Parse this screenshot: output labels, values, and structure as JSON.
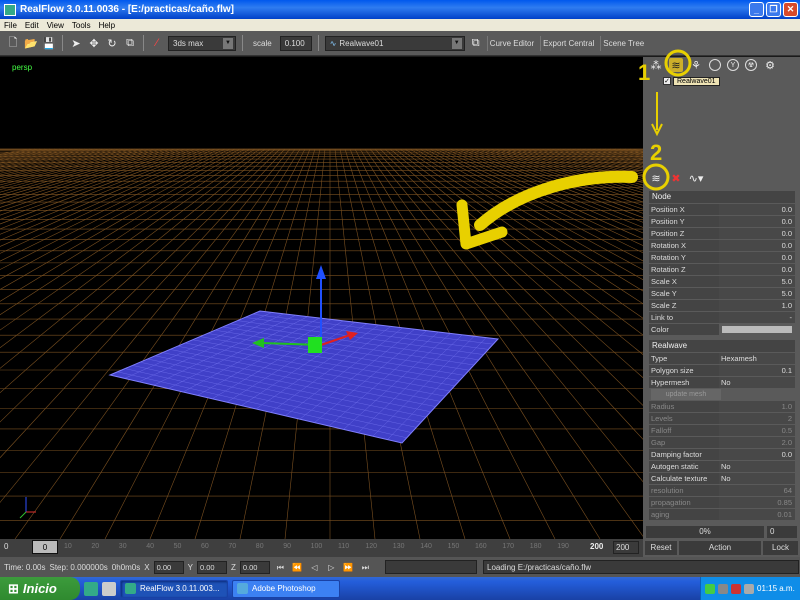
{
  "window": {
    "title": "RealFlow 3.0.11.0036 - [E:/practicas/caño.flw]"
  },
  "menu": [
    "File",
    "Edit",
    "View",
    "Tools",
    "Help"
  ],
  "toolbar": {
    "view_combo": "3ds max",
    "scale_label": "scale",
    "scale_value": "0.100",
    "object_combo": "Realwave01",
    "curve_editor": "Curve Editor",
    "export_central": "Export Central",
    "scene_tree": "Scene Tree"
  },
  "viewport": {
    "label": "persp"
  },
  "annotations": {
    "one": "1",
    "two": "2",
    "highlight_color": "#e8d000"
  },
  "scene": {
    "item_label": "Realwave01",
    "checked": true
  },
  "node_section": "Node",
  "node_props": [
    {
      "k": "Position X",
      "v": "0.0"
    },
    {
      "k": "Position Y",
      "v": "0.0"
    },
    {
      "k": "Position Z",
      "v": "0.0"
    },
    {
      "k": "Rotation X",
      "v": "0.0"
    },
    {
      "k": "Rotation Y",
      "v": "0.0"
    },
    {
      "k": "Rotation Z",
      "v": "0.0"
    },
    {
      "k": "Scale X",
      "v": "5.0"
    },
    {
      "k": "Scale Y",
      "v": "5.0"
    },
    {
      "k": "Scale Z",
      "v": "1.0"
    },
    {
      "k": "Link to",
      "v": "-"
    }
  ],
  "color_label": "Color",
  "realwave_section": "Realwave",
  "realwave_props": [
    {
      "k": "Type",
      "v": "Hexamesh"
    },
    {
      "k": "Polygon size",
      "v": "0.1"
    },
    {
      "k": "Hypermesh",
      "v": "No"
    }
  ],
  "update_mesh": "update mesh",
  "hyper_props": [
    {
      "k": "Radius",
      "v": "1.0"
    },
    {
      "k": "Levels",
      "v": "2"
    },
    {
      "k": "Falloff",
      "v": "0.5"
    },
    {
      "k": "Gap",
      "v": "2.0"
    }
  ],
  "more_props": [
    {
      "k": "Damping factor",
      "v": "0.0"
    },
    {
      "k": "Autogen static",
      "v": "No"
    },
    {
      "k": "Calculate texture",
      "v": "No"
    }
  ],
  "texture_props": [
    {
      "k": "resolution",
      "v": "64"
    },
    {
      "k": "propagation",
      "v": "0.85"
    },
    {
      "k": "aging",
      "v": "0.01"
    }
  ],
  "panel_bottom": {
    "percent": "0%",
    "zero": "0"
  },
  "timeline": {
    "start": "0",
    "current": "0",
    "end_label": "200",
    "end_value": "200",
    "ticks": [
      "10",
      "20",
      "30",
      "40",
      "50",
      "60",
      "70",
      "80",
      "90",
      "100",
      "110",
      "120",
      "130",
      "140",
      "150",
      "160",
      "170",
      "180",
      "190"
    ]
  },
  "action_bar": {
    "reset": "Reset",
    "action": "Action",
    "lock": "Lock"
  },
  "status": {
    "time": "Time: 0.00s",
    "step": "Step: 0.000000s",
    "clock": "0h0m0s",
    "x_label": "X",
    "x_value": "0.00",
    "y_label": "Y",
    "y_value": "0.00",
    "z_label": "Z",
    "z_value": "0.00",
    "loading": "Loading E:/practicas/caño.flw"
  },
  "taskbar": {
    "start": "Inicio",
    "task1": "RealFlow 3.0.11.003...",
    "task2": "Adobe Photoshop",
    "clock": "01:15 a.m."
  }
}
